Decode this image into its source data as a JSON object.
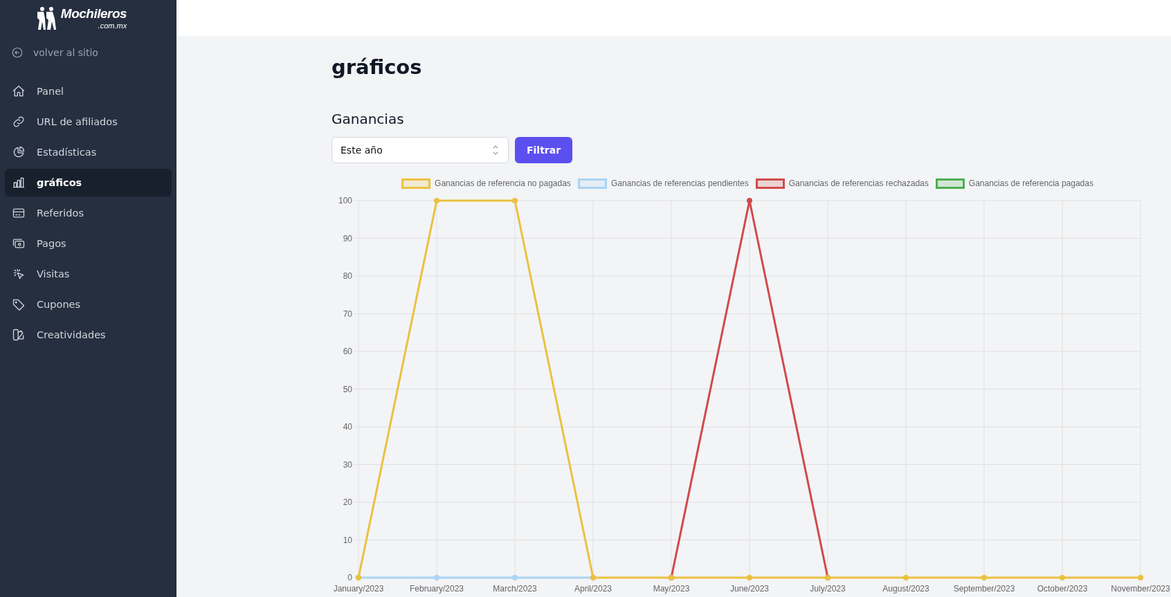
{
  "logo": {
    "name": "Mochileros",
    "domain": ".com.mx"
  },
  "back_link": "volver al sitio",
  "nav": [
    {
      "label": "Panel",
      "selected": false
    },
    {
      "label": "URL de afiliados",
      "selected": false
    },
    {
      "label": "Estadísticas",
      "selected": false
    },
    {
      "label": "gráficos",
      "selected": true
    },
    {
      "label": "Referidos",
      "selected": false
    },
    {
      "label": "Pagos",
      "selected": false
    },
    {
      "label": "Visitas",
      "selected": false
    },
    {
      "label": "Cupones",
      "selected": false
    },
    {
      "label": "Creatividades",
      "selected": false
    }
  ],
  "page_title": "gráficos",
  "section_title": "Ganancias",
  "period_select": {
    "value": "Este año"
  },
  "filter_button": "Filtrar",
  "chart_data": {
    "type": "line",
    "grid": true,
    "legend": true,
    "categories": [
      "January/2023",
      "February/2023",
      "March/2023",
      "April/2023",
      "May/2023",
      "June/2023",
      "July/2023",
      "August/2023",
      "September/2023",
      "October/2023",
      "November/2023"
    ],
    "ylim": [
      0,
      100
    ],
    "yticks": [
      0,
      10,
      20,
      30,
      40,
      50,
      60,
      70,
      80,
      90,
      100
    ],
    "series": [
      {
        "name": "Ganancias de referencia no pagadas",
        "color": "#ebc13f",
        "marker": "circle",
        "values": [
          0,
          100,
          100,
          0,
          0,
          0,
          0,
          0,
          0,
          0,
          0
        ]
      },
      {
        "name": "Ganancias de referencias pendientes",
        "color": "#a9d4f5",
        "marker": "circle",
        "values": [
          0,
          0,
          0,
          0,
          null,
          null,
          null,
          null,
          null,
          null,
          null
        ]
      },
      {
        "name": "Ganancias de referencias rechazadas",
        "color": "#d04a4a",
        "marker": "circle",
        "values": [
          null,
          null,
          null,
          null,
          0,
          100,
          0,
          null,
          null,
          null,
          null
        ]
      },
      {
        "name": "Ganancias de referencia pagadas",
        "color": "#4caf50",
        "values": [
          null,
          null,
          null,
          null,
          null,
          null,
          null,
          null,
          null,
          null,
          null
        ]
      }
    ]
  }
}
